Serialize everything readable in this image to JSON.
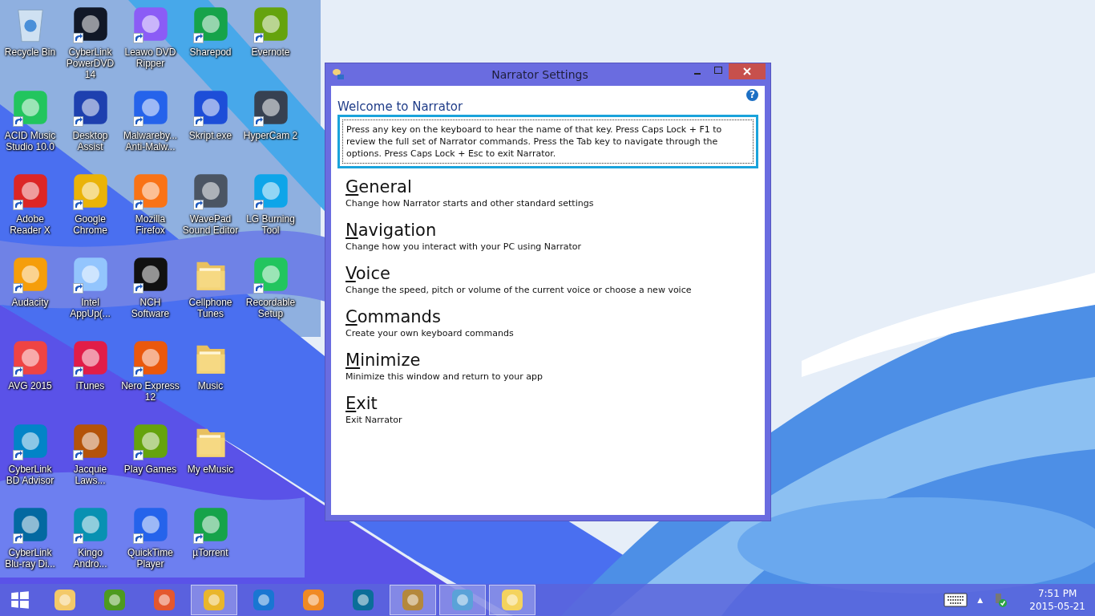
{
  "desktop_rows": [
    {
      "icons": [
        {
          "label": "Recycle Bin",
          "kind": "recycle-bin",
          "shortcut": false
        },
        {
          "label": "CyberLink PowerDVD 14",
          "kind": "app",
          "shortcut": true
        },
        {
          "label": "Leawo DVD Ripper",
          "kind": "app",
          "shortcut": true
        },
        {
          "label": "Sharepod",
          "kind": "app",
          "shortcut": true
        },
        {
          "label": "Evernote",
          "kind": "app",
          "shortcut": true
        }
      ]
    },
    {
      "icons": [
        {
          "label": "ACID Music Studio 10.0",
          "kind": "app",
          "shortcut": true
        },
        {
          "label": "Desktop Assist",
          "kind": "app",
          "shortcut": true
        },
        {
          "label": "Malwareby... Anti-Malw...",
          "kind": "app",
          "shortcut": true
        },
        {
          "label": "Skript.exe",
          "kind": "app",
          "shortcut": true
        },
        {
          "label": "HyperCam 2",
          "kind": "app",
          "shortcut": true
        }
      ]
    },
    {
      "icons": [
        {
          "label": "Adobe Reader X",
          "kind": "app",
          "shortcut": true
        },
        {
          "label": "Google Chrome",
          "kind": "app",
          "shortcut": true
        },
        {
          "label": "Mozilla Firefox",
          "kind": "app",
          "shortcut": true
        },
        {
          "label": "WavePad Sound Editor",
          "kind": "app",
          "shortcut": true
        },
        {
          "label": "LG Burning Tool",
          "kind": "app",
          "shortcut": true
        }
      ]
    },
    {
      "icons": [
        {
          "label": "Audacity",
          "kind": "app",
          "shortcut": true
        },
        {
          "label": "Intel AppUp(...",
          "kind": "app",
          "shortcut": true
        },
        {
          "label": "NCH Software",
          "kind": "app",
          "shortcut": true
        },
        {
          "label": "Cellphone Tunes",
          "kind": "folder",
          "shortcut": false
        },
        {
          "label": "Recordable Setup",
          "kind": "app",
          "shortcut": true
        }
      ]
    },
    {
      "icons": [
        {
          "label": "AVG 2015",
          "kind": "app",
          "shortcut": true
        },
        {
          "label": "iTunes",
          "kind": "app",
          "shortcut": true
        },
        {
          "label": "Nero Express 12",
          "kind": "app",
          "shortcut": true
        },
        {
          "label": "Music",
          "kind": "folder",
          "shortcut": false
        }
      ]
    },
    {
      "icons": [
        {
          "label": "CyberLink BD Advisor",
          "kind": "app",
          "shortcut": true
        },
        {
          "label": "Jacquie Laws...",
          "kind": "app",
          "shortcut": true
        },
        {
          "label": "Play Games",
          "kind": "app",
          "shortcut": true
        },
        {
          "label": "My eMusic",
          "kind": "folder",
          "shortcut": false
        }
      ]
    },
    {
      "icons": [
        {
          "label": "CyberLink Blu-ray Di...",
          "kind": "app",
          "shortcut": true
        },
        {
          "label": "Kingo Andro...",
          "kind": "app",
          "shortcut": true
        },
        {
          "label": "QuickTime Player",
          "kind": "app",
          "shortcut": true
        },
        {
          "label": "µTorrent",
          "kind": "app",
          "shortcut": true
        }
      ]
    }
  ],
  "window": {
    "title": "Narrator Settings",
    "help": "?",
    "heading": "Welcome to Narrator",
    "intro": "Press any key on the keyboard to hear the name of that key.  Press Caps Lock + F1 to review the full set of Narrator commands.  Press the Tab key to navigate through the options.  Press Caps Lock + Esc to exit Narrator.",
    "sections": [
      {
        "title": "General",
        "description": "Change how Narrator starts and other standard settings"
      },
      {
        "title": "Navigation",
        "description": "Change how you interact with your PC using Narrator"
      },
      {
        "title": "Voice",
        "description": "Change the speed, pitch or volume of the current voice or choose a new voice"
      },
      {
        "title": "Commands",
        "description": "Create your own keyboard commands"
      },
      {
        "title": "Minimize",
        "description": "Minimize this window and return to your app"
      },
      {
        "title": "Exit",
        "description": "Exit Narrator"
      }
    ]
  },
  "taskbar": {
    "apps": [
      {
        "selected": false
      },
      {
        "selected": false
      },
      {
        "selected": false
      },
      {
        "selected": true
      },
      {
        "selected": false
      },
      {
        "selected": false
      },
      {
        "selected": false
      },
      {
        "selected": true
      },
      {
        "selected": true
      },
      {
        "selected": true
      }
    ],
    "tray": {
      "show_hidden": "▲",
      "time": "7:51 PM",
      "date": "2015-05-21"
    }
  }
}
